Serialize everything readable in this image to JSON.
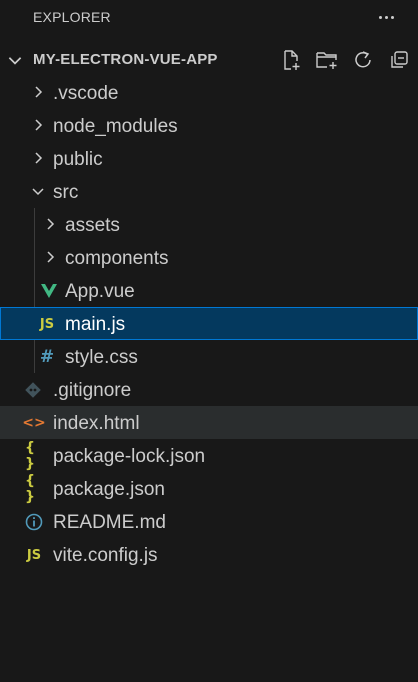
{
  "panel": {
    "title": "EXPLORER"
  },
  "project": {
    "name": "MY-ELECTRON-VUE-APP"
  },
  "tree": {
    "vscode": ".vscode",
    "node_modules": "node_modules",
    "public": "public",
    "src": "src",
    "assets": "assets",
    "components": "components",
    "app_vue": "App.vue",
    "main_js": "main.js",
    "style_css": "style.css",
    "gitignore": ".gitignore",
    "index_html": "index.html",
    "package_lock": "package-lock.json",
    "package_json": "package.json",
    "readme": "README.md",
    "vite_config": "vite.config.js"
  },
  "icon_glyphs": {
    "js": "JS",
    "css": "#",
    "json": "{ }",
    "html": "<>",
    "info": "i"
  },
  "colors": {
    "background": "#181818",
    "selection": "#04395e",
    "selection_border": "#0078d4",
    "vue": "#41b883",
    "js": "#cbcb41",
    "css": "#519aba",
    "json": "#cbcb41",
    "html": "#e37933"
  },
  "icons": [
    "chevron-right-icon",
    "chevron-down-icon",
    "vue-icon",
    "js-icon",
    "css-icon",
    "json-icon",
    "html-icon",
    "git-icon",
    "info-icon",
    "new-file-icon",
    "new-folder-icon",
    "refresh-icon",
    "collapse-all-icon",
    "more-icon"
  ]
}
